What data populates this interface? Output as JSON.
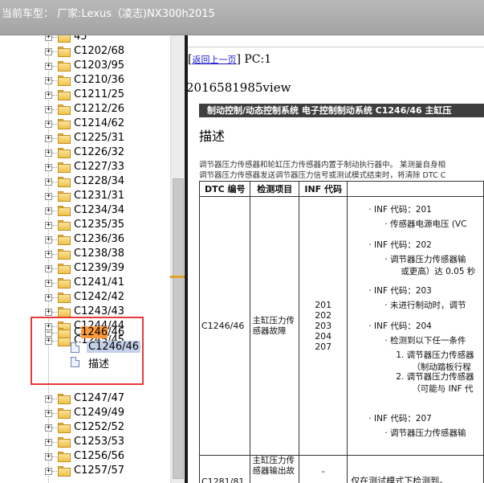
{
  "title": "当前车型：  厂家:Lexus（凌志)NX300h2015",
  "tree": {
    "partial_top": "45",
    "items": [
      "C1202/68",
      "C1203/95",
      "C1210/36",
      "C1211/25",
      "C1212/26",
      "C1214/62",
      "C1225/31",
      "C1226/32",
      "C1227/33",
      "C1228/34",
      "C1231/31",
      "C1234/34",
      "C1235/35",
      "C1236/36",
      "C1238/38",
      "C1239/39",
      "C1241/41",
      "C1242/42",
      "C1243/43",
      "C1244/44",
      "C1245/45"
    ],
    "expanded": {
      "label_prefix": "C",
      "label_highlight": "1246",
      "label_suffix": "/46",
      "child_selected": "C1246/46",
      "child_desc": "描述"
    },
    "items_after": [
      "C1247/47",
      "C1249/49",
      "C1252/52",
      "C1253/53",
      "C1256/56",
      "C1257/57"
    ]
  },
  "content": {
    "back_link": "返回上一页",
    "pc": "PC:1",
    "view_id": "2016581985view",
    "section_bar": "制动控制/动态控制系统  电子控制制动系统  C1246/46  主缸压",
    "desc_title": "描述",
    "para_line1": "调节器压力传感器和轮缸压力传感器内置于制动执行器中。 某测量自身相",
    "para_line2": "调节器压力传感器发送调节器压力信号或测试模式结束时，将清除 DTC C",
    "table": {
      "headers": [
        "DTC 编号",
        "检测项目",
        "INF 代码",
        ""
      ],
      "row1": {
        "dtc": "C1246/46",
        "item": "主缸压力传感器故障",
        "inf_codes": [
          "201",
          "202",
          "203",
          "204",
          "207"
        ],
        "detail": [
          "·  INF 代码：201",
          "·  传感器电源电压 (VC",
          "·  INF 代码：202",
          "·  调节器压力传感器输",
          "或更高）达 0.05 秒",
          "·  INF 代码：203",
          "·  未进行制动时，调节",
          "·  INF 代码：204",
          "·  检测到以下任一条件",
          "1.  调节器压力传感器",
          "（制动踏板行程",
          "2.  调节器压力传感器",
          "（可能与 INF 代",
          "·  INF 代码：207",
          "·  调节器压力传感器输"
        ]
      },
      "row2": {
        "dtc": "C1281/81",
        "item": "主缸压力传感器输出故",
        "inf": "-",
        "detail": "仅在测试模式下检测到。"
      }
    }
  }
}
